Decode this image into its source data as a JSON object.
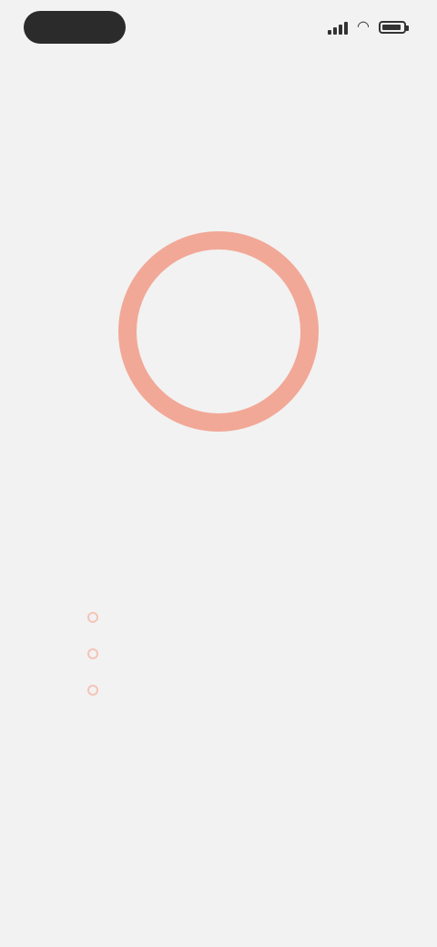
{
  "status_bar": {
    "time": "",
    "battery_level": 0.9,
    "icons": [
      "signal-icon",
      "wifi-icon",
      "battery-icon"
    ]
  },
  "progress": {
    "label": ""
  },
  "headline": "",
  "steps": [
    {
      "text": ""
    },
    {
      "text": ""
    },
    {
      "text": ""
    }
  ],
  "colors": {
    "background": "#f2f2f2",
    "accent": "#f2a897",
    "accent_text": "#ee9f8f",
    "text_dark": "#222222"
  }
}
